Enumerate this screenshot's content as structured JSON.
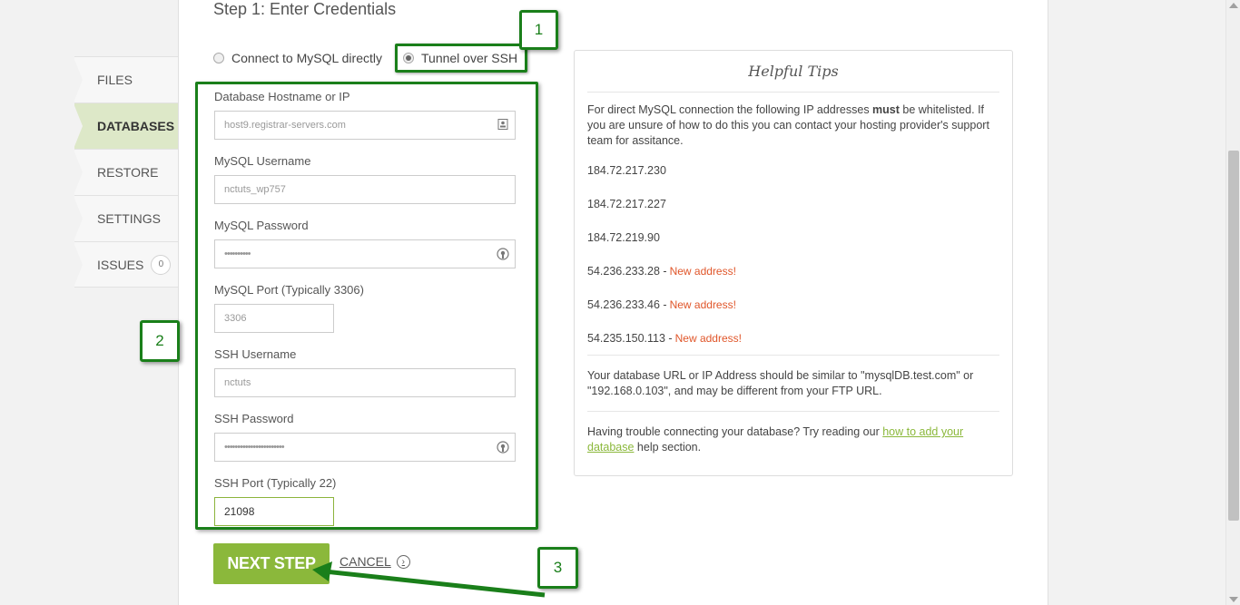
{
  "sidebar": {
    "items": [
      {
        "label": "FILES",
        "active": false
      },
      {
        "label": "DATABASES",
        "active": true
      },
      {
        "label": "RESTORE",
        "active": false
      },
      {
        "label": "SETTINGS",
        "active": false
      },
      {
        "label": "ISSUES",
        "active": false,
        "count": "0"
      }
    ]
  },
  "main": {
    "step_title": "Step 1: Enter Credentials",
    "connection": {
      "option_direct": "Connect to MySQL directly",
      "option_ssh": "Tunnel over SSH",
      "selected": "Tunnel over SSH"
    },
    "fields": {
      "db_host": {
        "label": "Database Hostname or IP",
        "value": "host9.registrar-servers.com"
      },
      "mysql_user": {
        "label": "MySQL Username",
        "value": "nctuts_wp757"
      },
      "mysql_pass": {
        "label": "MySQL Password",
        "value": "••••••••••"
      },
      "mysql_port": {
        "label": "MySQL Port (Typically 3306)",
        "value": "3306"
      },
      "ssh_user": {
        "label": "SSH Username",
        "value": "nctuts"
      },
      "ssh_pass": {
        "label": "SSH Password",
        "value": "•••••••••••••••••••••••"
      },
      "ssh_port": {
        "label": "SSH Port (Typically 22)",
        "value": "21098"
      }
    },
    "buttons": {
      "next": "NEXT STEP",
      "cancel": "CANCEL"
    },
    "callouts": [
      "1",
      "2",
      "3"
    ]
  },
  "tips": {
    "title": "Helpful Tips",
    "intro_before": "For direct MySQL connection the following IP addresses ",
    "intro_bold": "must",
    "intro_after": " be whitelisted. If you are unsure of how to do this you can contact your hosting provider's support team for assitance.",
    "ips": [
      {
        "ip": "184.72.217.230",
        "note": ""
      },
      {
        "ip": "184.72.217.227",
        "note": ""
      },
      {
        "ip": "184.72.219.90",
        "note": ""
      },
      {
        "ip": "54.236.233.28 -",
        "note": "New address!"
      },
      {
        "ip": "54.236.233.46 -",
        "note": "New address!"
      },
      {
        "ip": "54.235.150.113 -",
        "note": "New address!"
      }
    ],
    "url_note": "Your database URL or IP Address should be similar to \"mysqlDB.test.com\" or \"192.168.0.103\", and may be different from your FTP URL.",
    "help_before": "Having trouble connecting your database? Try reading our ",
    "help_link": "how to add your database",
    "help_after": " help section."
  },
  "colors": {
    "accent_green": "#8bb83b",
    "callout_green": "#1a7f1a",
    "new_address": "#e0562a"
  },
  "icons": {
    "db_host": "contact-card-icon",
    "password": "password-reveal-icon",
    "cancel": "chevron-right-circle-icon"
  }
}
